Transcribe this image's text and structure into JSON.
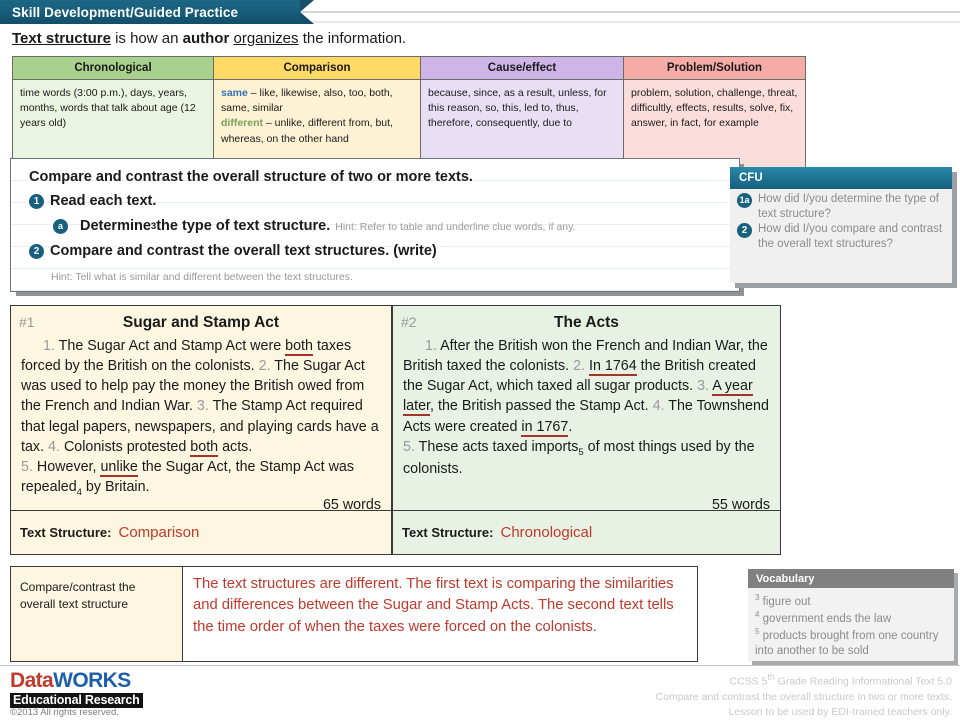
{
  "title_bar": {
    "label": "Skill Development/Guided Practice"
  },
  "intro": {
    "part1": "Text structure",
    "part2": " is how an ",
    "part3": "author",
    "part4": " ",
    "part5": "organizes",
    "part6": " the information."
  },
  "clue_table": {
    "headers": [
      "Chronological",
      "Comparison",
      "Cause/effect",
      "Problem/Solution"
    ],
    "cells": {
      "chronological": "time words (3:00 p.m.), days, years, months, words that talk about age (12 years old)",
      "comparison_same_label": "same",
      "comparison_same_text": " – like, likewise, also, too, both, same, similar",
      "comparison_diff_label": "different",
      "comparison_diff_text": " – unlike, different from, but, whereas, on the other hand",
      "cause_effect": "because, since, as a result, unless, for this reason, so, this, led to, thus, therefore, consequently, due to",
      "problem_solution": "problem, solution, challenge, threat, difficultly, effects, results, solve, fix, answer, in fact, for example"
    }
  },
  "instruction": {
    "objective": "Compare and contrast the overall structure of two or more texts.",
    "step1_marker": "1",
    "step1_text": "Read each text.",
    "step1a_marker": "a",
    "step1a_text": "Determine",
    "step1a_sub": "3",
    "step1a_text2": " the type of text structure.",
    "step1a_hint": "Hint: Refer to table and underline clue words, if any.",
    "step2_marker": "2",
    "step2_text": "Compare and contrast the overall text structures. (write)",
    "step2_hint": "Hint: Tell what is similar and different between the text structures."
  },
  "cfu": {
    "title": "CFU",
    "items": [
      {
        "marker": "1a",
        "text": "How did I/you determine the type of text structure?"
      },
      {
        "marker": "2",
        "text": "How did I/you compare and contrast the overall text structures?"
      }
    ]
  },
  "passages": [
    {
      "number": "#1",
      "title": "Sugar and Stamp Act",
      "sentences": [
        {
          "n": "1.",
          "text": " The Sugar Act and Stamp Act were ",
          "clue": "both",
          "tail": " taxes forced by the British on the colonists."
        },
        {
          "n": "2.",
          "text": " The Sugar Act was used to help pay the money the British owed from the French and Indian War.",
          "clue": "",
          "tail": ""
        },
        {
          "n": "3.",
          "text": " The Stamp Act required that legal papers, newspapers, and playing cards have a tax.",
          "clue": "",
          "tail": ""
        },
        {
          "n": "4.",
          "text": " Colonists protested ",
          "clue": "both",
          "tail": " acts."
        },
        {
          "n": "5.",
          "text": " However, ",
          "clue": "unlike",
          "tail": " the Sugar Act, the Stamp Act was repealed",
          "sub": "4",
          "tail2": " by Britain."
        }
      ],
      "word_count": "65 words",
      "ts_label": "Text Structure:",
      "ts_answer": "Comparison"
    },
    {
      "number": "#2",
      "title": "The Acts",
      "sentences": [
        {
          "n": "1.",
          "text": " After the British won the French and Indian War, the British taxed the colonists.",
          "clue": "",
          "tail": ""
        },
        {
          "n": "2.",
          "text": " ",
          "clue": "In 1764",
          "tail": " the British created the Sugar Act, which taxed all sugar products."
        },
        {
          "n": "3.",
          "text": " ",
          "clue": "A year later",
          "tail": ", the British passed the Stamp Act."
        },
        {
          "n": "4.",
          "text": " The Townshend Acts were created ",
          "clue": "in 1767",
          "tail": "."
        },
        {
          "n": "5.",
          "text": " These acts taxed imports",
          "sub": "5",
          "tail2": " of most things used by the colonists.",
          "clue": "",
          "tail": ""
        }
      ],
      "word_count": "55 words",
      "ts_label": "Text Structure:",
      "ts_answer": "Chronological"
    }
  ],
  "compare_contrast": {
    "prompt": "Compare/contrast the overall text structure",
    "answer": "The text structures are different. The first text is comparing the similarities and differences between the Sugar and Stamp Acts. The second text tells the time order of when the taxes were forced on the colonists."
  },
  "vocabulary": {
    "title": "Vocabulary",
    "items": [
      {
        "num": "3",
        "text": "figure out"
      },
      {
        "num": "4",
        "text": "government ends the law"
      },
      {
        "num": "5",
        "text": "products brought from one country into another to be sold"
      }
    ]
  },
  "footer": {
    "logo_data": "Data",
    "logo_works": "WORKS",
    "logo_sub": "Educational Research",
    "copyright": "©2013 All rights reserved.",
    "credit_line1_a": "CCSS 5",
    "credit_line1_sup": "th",
    "credit_line1_b": " Grade Reading Informational Text 5.0",
    "credit_line2": "Compare and contrast the overall structure in two or more texts.",
    "credit_line3": "Lesson to be used by EDI-trained teachers only."
  }
}
